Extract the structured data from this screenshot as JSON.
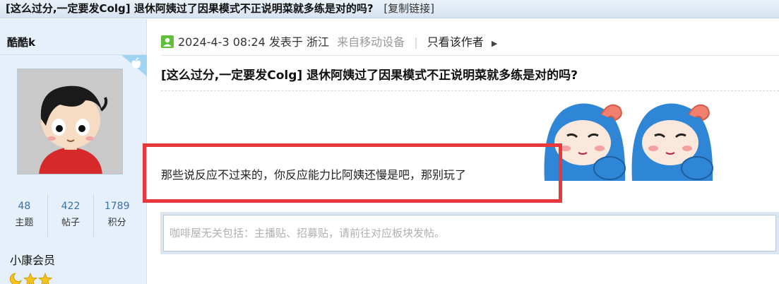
{
  "titlebar": {
    "title": "[这么过分,一定要发Colg] 退休阿姨过了因果模式不正说明菜就多练是对的吗?",
    "copy_link": "[复制链接]"
  },
  "sidebar": {
    "username": "酷酷k",
    "stats": [
      {
        "value": "48",
        "label": "主题"
      },
      {
        "value": "422",
        "label": "帖子"
      },
      {
        "value": "1789",
        "label": "积分"
      }
    ],
    "level": "小康会员",
    "level_icons": [
      "moon-icon",
      "star-icon",
      "star-icon"
    ]
  },
  "post": {
    "date": "2024-4-3 08:24",
    "posted_in": "发表于",
    "location": "浙江",
    "device": "来自移动设备",
    "only_author": "只看该作者",
    "title": "[这么过分,一定要发Colg] 退休阿姨过了因果模式不正说明菜就多练是对的吗?",
    "body": "那些说反应不过来的，你反应能力比阿姨还慢是吧，那别玩了"
  },
  "reply": {
    "placeholder": "咖啡屋无关包括：主播贴、招募贴，请前往对应板块发帖。"
  },
  "colors": {
    "highlight": "#e8383b",
    "sidebar_bg": "#e6f0fb",
    "stat_number": "#3a6fa6",
    "sticker_blue": "#2f86d6"
  }
}
